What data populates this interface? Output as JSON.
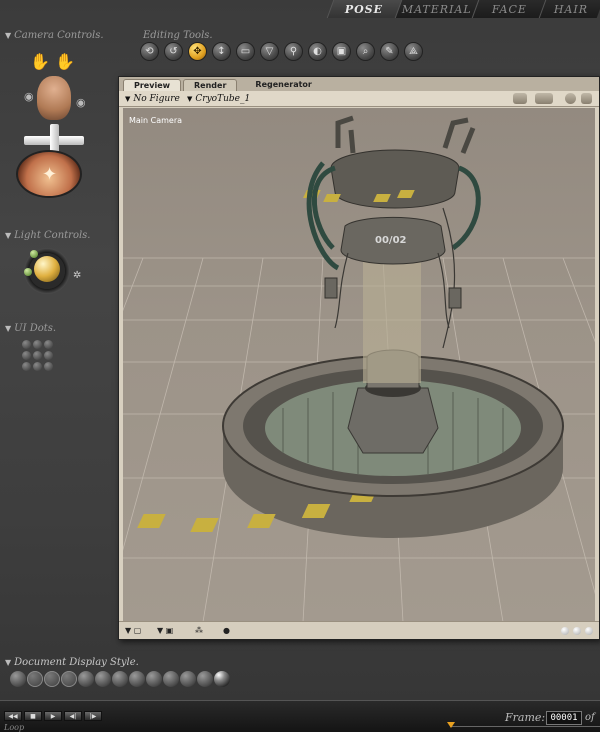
{
  "room_tabs": [
    {
      "label": "POSE",
      "active": true
    },
    {
      "label": "MATERIAL",
      "active": false
    },
    {
      "label": "FACE",
      "active": false
    },
    {
      "label": "HAIR",
      "active": false
    }
  ],
  "sections": {
    "camera_controls": "Camera Controls.",
    "editing_tools": "Editing Tools.",
    "light_controls": "Light Controls.",
    "ui_dots": "UI Dots.",
    "document_display_style": "Document Display Style."
  },
  "editing_tools": [
    {
      "icon": "rotate-icon",
      "glyph": "⟲"
    },
    {
      "icon": "twist-icon",
      "glyph": "↺"
    },
    {
      "icon": "translate-icon",
      "glyph": "✥",
      "active": true
    },
    {
      "icon": "translate-in-out-icon",
      "glyph": "↕"
    },
    {
      "icon": "scale-icon",
      "glyph": "▭"
    },
    {
      "icon": "taper-icon",
      "glyph": "▽"
    },
    {
      "icon": "chain-break-icon",
      "glyph": "⚲"
    },
    {
      "icon": "color-icon",
      "glyph": "◐"
    },
    {
      "icon": "grouping-icon",
      "glyph": "▣"
    },
    {
      "icon": "view-magnifier-icon",
      "glyph": "⌕"
    },
    {
      "icon": "morphing-tool-icon",
      "glyph": "✎"
    },
    {
      "icon": "direct-manipulation-icon",
      "glyph": "⟁"
    }
  ],
  "document": {
    "tabs": [
      "Preview",
      "Render",
      "Regenerator"
    ],
    "active_tab": "Preview",
    "figure_select": "No Figure",
    "actor_select": "CryoTube_1",
    "camera_label": "Main Camera",
    "scene_object_text": "00/02"
  },
  "timeline": {
    "frame_label": "Frame:",
    "frame_value": "00001",
    "of_label": "of",
    "loop_label": "Loop"
  },
  "colors": {
    "active_tool": "#e0a020",
    "viewport_bg": "#9c9388",
    "doc_frame": "#d8d0c0"
  }
}
